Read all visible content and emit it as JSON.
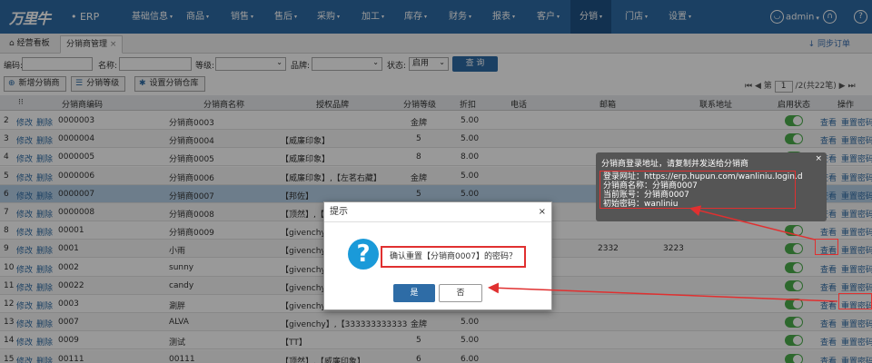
{
  "app": {
    "logo": "万里牛",
    "erp": "• ERP",
    "user": "admin",
    "user_caret": "▾"
  },
  "nav": [
    "基础信息",
    "商品",
    "销售",
    "售后",
    "采购",
    "加工",
    "库存",
    "财务",
    "报表",
    "客户",
    "分销",
    "门店",
    "设置"
  ],
  "tabs": {
    "home": "经营看板",
    "current": "分销商管理",
    "sync": "同步订单"
  },
  "filter": {
    "code": "编码:",
    "name": "名称:",
    "level": "等级:",
    "brand": "品牌:",
    "status": "状态:",
    "status_value": "启用",
    "query": "查 询"
  },
  "toolbar": {
    "add": "新增分销商",
    "level": "分销等级",
    "warehouse": "设置分销仓库"
  },
  "pager": {
    "page": "1",
    "label_before": "第",
    "label_after": "/2(共22笔)"
  },
  "columns": {
    "code": "分销商编码",
    "name": "分销商名称",
    "brand": "授权品牌",
    "level": "分销等级",
    "discount": "折扣",
    "phone": "电话",
    "email": "邮箱",
    "address": "联系地址",
    "enabled": "启用状态",
    "op": "操作"
  },
  "actions": {
    "edit": "修改",
    "del": "删除",
    "view": "查看",
    "reset": "重置密码"
  },
  "rows": [
    {
      "n": "2",
      "code": "0000003",
      "name": "分销商0003",
      "brand": "",
      "level": "金牌",
      "discount": "5.00",
      "phone": "",
      "email": "",
      "addr": ""
    },
    {
      "n": "3",
      "code": "0000004",
      "name": "分销商0004",
      "brand": "【威廉印象】",
      "level": "5",
      "discount": "5.00",
      "phone": "",
      "email": "",
      "addr": ""
    },
    {
      "n": "4",
      "code": "0000005",
      "name": "分销商0005",
      "brand": "【威廉印象】",
      "level": "8",
      "discount": "8.00",
      "phone": "",
      "email": "",
      "addr": ""
    },
    {
      "n": "5",
      "code": "0000006",
      "name": "分销商0006",
      "brand": "【威廉印象】,【左茗右藏】",
      "level": "金牌",
      "discount": "5.00",
      "phone": "",
      "email": "",
      "addr": ""
    },
    {
      "n": "6",
      "code": "0000007",
      "name": "分销商0007",
      "brand": "【邦佐】",
      "level": "5",
      "discount": "5.00",
      "phone": "",
      "email": "",
      "addr": ""
    },
    {
      "n": "7",
      "code": "0000008",
      "name": "分销商0008",
      "brand": "【顶然】,【威",
      "level": "",
      "discount": "",
      "phone": "",
      "email": "",
      "addr": ""
    },
    {
      "n": "8",
      "code": "00001",
      "name": "分销商0009",
      "brand": "【givenchy】",
      "level": "",
      "discount": "",
      "phone": "",
      "email": "",
      "addr": ""
    },
    {
      "n": "9",
      "code": "0001",
      "name": "小雨",
      "brand": "【givenchy】",
      "level": "",
      "discount": "",
      "phone": "",
      "email": "2332",
      "addr": "3223"
    },
    {
      "n": "10",
      "code": "0002",
      "name": "sunny",
      "brand": "【givenchy】",
      "level": "",
      "discount": "",
      "phone": "",
      "email": "",
      "addr": ""
    },
    {
      "n": "11",
      "code": "00022",
      "name": "candy",
      "brand": "【givenchy】",
      "level": "",
      "discount": "",
      "phone": "",
      "email": "",
      "addr": ""
    },
    {
      "n": "12",
      "code": "0003",
      "name": "涮胖",
      "brand": "【givenchy】",
      "level": "",
      "discount": "",
      "phone": "",
      "email": "",
      "addr": ""
    },
    {
      "n": "13",
      "code": "0007",
      "name": "ALVA",
      "brand": "【givenchy】,【333333333333",
      "level": "金牌",
      "discount": "5.00",
      "phone": "",
      "email": "",
      "addr": ""
    },
    {
      "n": "14",
      "code": "0009",
      "name": "测试",
      "brand": "【TT】",
      "level": "5",
      "discount": "5.00",
      "phone": "",
      "email": "",
      "addr": ""
    },
    {
      "n": "15",
      "code": "00111",
      "name": "00111",
      "brand": "【顶然】,【威廉印象】",
      "level": "6",
      "discount": "6.00",
      "phone": "",
      "email": "",
      "addr": ""
    }
  ],
  "tip": {
    "title": "分销商登录地址，请复制并发送给分销商",
    "url": "登录网址：https://erp.hupun.com/wanliniu.login.d",
    "name": "分销商名称：分销商0007",
    "account": "当前账号：分销商0007",
    "password": "初始密码：wanliniu",
    "close": "×"
  },
  "dialog": {
    "title": "提示",
    "close": "×",
    "message": "确认重置【分销商0007】的密码？",
    "yes": "是",
    "no": "否"
  },
  "colors": {
    "primary": "#2e6ca6",
    "highlight": "#e03030",
    "toggle": "#4cae4c"
  }
}
